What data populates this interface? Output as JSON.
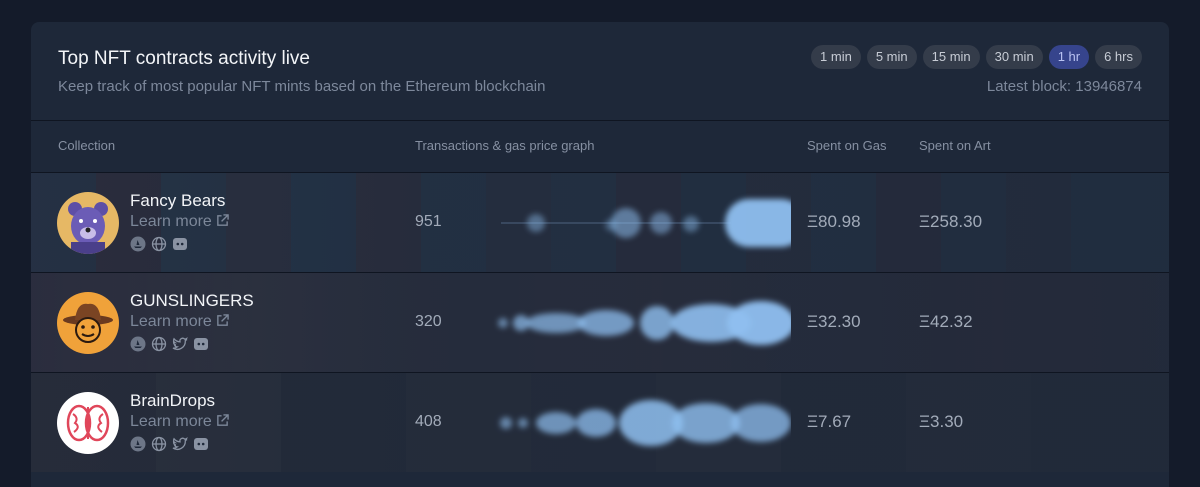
{
  "header": {
    "title": "Top NFT contracts activity live",
    "subtitle": "Keep track of most popular NFT mints based on the Ethereum blockchain",
    "latest_block": "Latest block: 13946874",
    "ranges": [
      "1 min",
      "5 min",
      "15 min",
      "30 min",
      "1 hr",
      "6 hrs"
    ],
    "active_range": "1 hr"
  },
  "columns": {
    "collection": "Collection",
    "graph": "Transactions & gas price graph",
    "gas": "Spent on Gas",
    "art": "Spent on Art"
  },
  "rows": [
    {
      "name": "Fancy Bears",
      "learn_more": "Learn more",
      "transactions": "951",
      "spent_gas": "Ξ80.98",
      "spent_art": "Ξ258.30",
      "socials": [
        "opensea-icon",
        "globe-icon",
        "discord-icon"
      ]
    },
    {
      "name": "GUNSLINGERS",
      "learn_more": "Learn more",
      "transactions": "320",
      "spent_gas": "Ξ32.30",
      "spent_art": "Ξ42.32",
      "socials": [
        "opensea-icon",
        "globe-icon",
        "twitter-icon",
        "discord-icon"
      ]
    },
    {
      "name": "BrainDrops",
      "learn_more": "Learn more",
      "transactions": "408",
      "spent_gas": "Ξ7.67",
      "spent_art": "Ξ3.30",
      "socials": [
        "opensea-icon",
        "globe-icon",
        "twitter-icon",
        "discord-icon"
      ]
    }
  ],
  "colors": {
    "page_bg": "#141b2a",
    "card_bg": "#1e2839",
    "active_chip": "#36448c",
    "graph_blob": "#8fbff0"
  }
}
